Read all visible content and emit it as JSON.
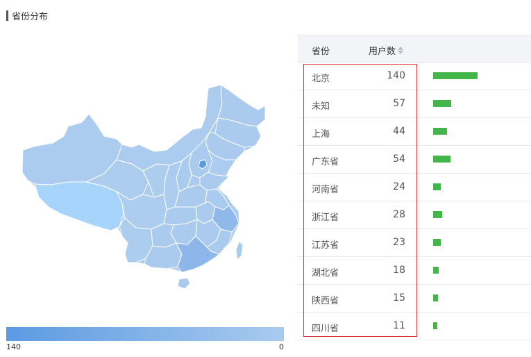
{
  "section": {
    "title": "省份分布"
  },
  "colors": {
    "map_high": "#5b9ae2",
    "map_low": "#a9cbef",
    "map_zero": "#a6d4fa",
    "map_border": "#ffffff",
    "bar": "#44b548",
    "highlight": "#d63a3a"
  },
  "map": {
    "legend": {
      "max_label": "140",
      "min_label": "0",
      "max": 140,
      "min": 0
    }
  },
  "table": {
    "headers": {
      "province": "省份",
      "users": "用户数"
    },
    "sort_icon": "sort-icon",
    "rows": [
      {
        "province": "北京",
        "users": "140",
        "value": 140
      },
      {
        "province": "未知",
        "users": "57",
        "value": 57
      },
      {
        "province": "上海",
        "users": "44",
        "value": 44
      },
      {
        "province": "广东省",
        "users": "54",
        "value": 54
      },
      {
        "province": "河南省",
        "users": "24",
        "value": 24
      },
      {
        "province": "浙江省",
        "users": "28",
        "value": 28
      },
      {
        "province": "江苏省",
        "users": "23",
        "value": 23
      },
      {
        "province": "湖北省",
        "users": "18",
        "value": 18
      },
      {
        "province": "陕西省",
        "users": "15",
        "value": 15
      },
      {
        "province": "四川省",
        "users": "11",
        "value": 11
      }
    ]
  }
}
